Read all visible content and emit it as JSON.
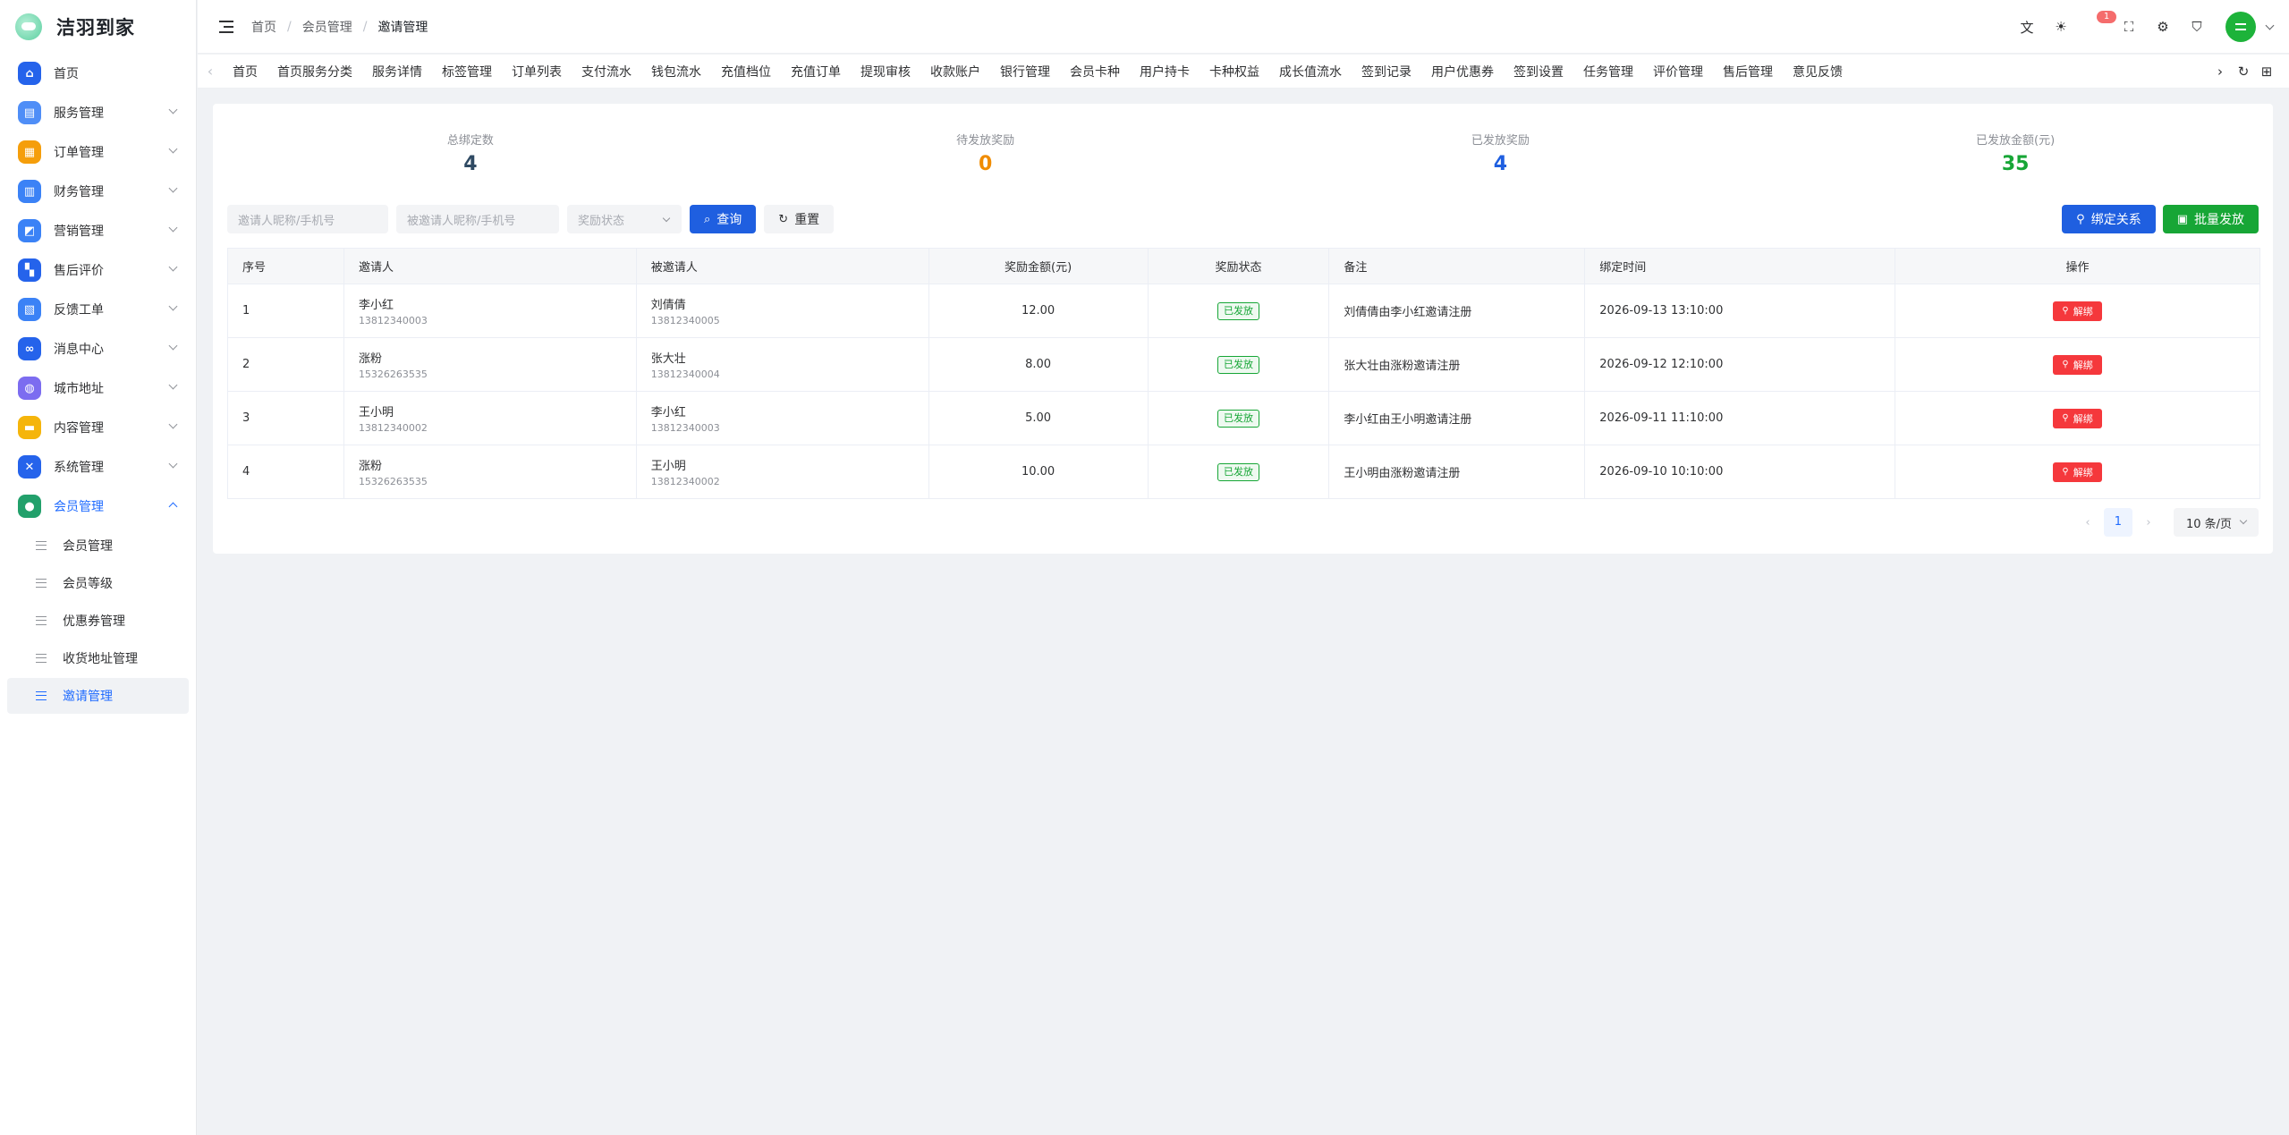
{
  "app": {
    "name": "洁羽到家"
  },
  "colors": {
    "primary": "#1f5fe0",
    "success": "#17a636",
    "danger": "#f5383c",
    "warning": "#f08c00",
    "stat_blue": "#1f5fe0",
    "stat_dark": "#2f4a63"
  },
  "sidebar": {
    "items": [
      {
        "label": "首页",
        "icon": "home-icon",
        "color": "#2563eb",
        "glyph": "⌂"
      },
      {
        "label": "服务管理",
        "icon": "clipboard-icon",
        "color": "#4f8ef7",
        "glyph": "▤"
      },
      {
        "label": "订单管理",
        "icon": "order-icon",
        "color": "#f59e0b",
        "glyph": "▦"
      },
      {
        "label": "财务管理",
        "icon": "document-icon",
        "color": "#3b82f6",
        "glyph": "▥"
      },
      {
        "label": "营销管理",
        "icon": "chart-icon",
        "color": "#3b82f6",
        "glyph": "◩"
      },
      {
        "label": "售后评价",
        "icon": "grid-icon",
        "color": "#2563eb",
        "glyph": "▚"
      },
      {
        "label": "反馈工单",
        "icon": "feedback-icon",
        "color": "#3b82f6",
        "glyph": "▧"
      },
      {
        "label": "消息中心",
        "icon": "link-icon",
        "color": "#2563eb",
        "glyph": "∞"
      },
      {
        "label": "城市地址",
        "icon": "planet-icon",
        "color": "#7c6cf0",
        "glyph": "◍"
      },
      {
        "label": "内容管理",
        "icon": "folder-icon",
        "color": "#f5b50b",
        "glyph": "▬"
      },
      {
        "label": "系统管理",
        "icon": "tools-icon",
        "color": "#2563eb",
        "glyph": "✕"
      },
      {
        "label": "会员管理",
        "icon": "user-icon",
        "color": "#22a06b",
        "glyph": "●"
      }
    ],
    "sub_items": [
      "会员管理",
      "会员等级",
      "优惠券管理",
      "收货地址管理",
      "邀请管理"
    ]
  },
  "header": {
    "breadcrumb": [
      "首页",
      "会员管理",
      "邀请管理"
    ],
    "badge_count": "1"
  },
  "tabs": [
    "首页",
    "首页服务分类",
    "服务详情",
    "标签管理",
    "订单列表",
    "支付流水",
    "钱包流水",
    "充值档位",
    "充值订单",
    "提现审核",
    "收款账户",
    "银行管理",
    "会员卡种",
    "用户持卡",
    "卡种权益",
    "成长值流水",
    "签到记录",
    "用户优惠券",
    "签到设置",
    "任务管理",
    "评价管理",
    "售后管理",
    "意见反馈"
  ],
  "stats": [
    {
      "label": "总绑定数",
      "value": "4",
      "color": "#2f4a63"
    },
    {
      "label": "待发放奖励",
      "value": "0",
      "color": "#f08c00"
    },
    {
      "label": "已发放奖励",
      "value": "4",
      "color": "#1f5fe0"
    },
    {
      "label": "已发放金额(元)",
      "value": "35",
      "color": "#17a636"
    }
  ],
  "search": {
    "inviter_placeholder": "邀请人昵称/手机号",
    "invitee_placeholder": "被邀请人昵称/手机号",
    "status_placeholder": "奖励状态",
    "query_label": "查询",
    "reset_label": "重置",
    "bind_label": "绑定关系",
    "batch_label": "批量发放"
  },
  "table": {
    "headers": [
      "序号",
      "邀请人",
      "被邀请人",
      "奖励金额(元)",
      "奖励状态",
      "备注",
      "绑定时间",
      "操作"
    ],
    "rows": [
      {
        "no": "1",
        "inviter": "李小红",
        "inviter_phone": "13812340003",
        "invitee": "刘倩倩",
        "invitee_phone": "13812340005",
        "amount": "12.00",
        "status": "已发放",
        "remark": "刘倩倩由李小红邀请注册",
        "time": "2026-09-13 13:10:00",
        "action": "解绑"
      },
      {
        "no": "2",
        "inviter": "涨粉",
        "inviter_phone": "15326263535",
        "invitee": "张大壮",
        "invitee_phone": "13812340004",
        "amount": "8.00",
        "status": "已发放",
        "remark": "张大壮由涨粉邀请注册",
        "time": "2026-09-12 12:10:00",
        "action": "解绑"
      },
      {
        "no": "3",
        "inviter": "王小明",
        "inviter_phone": "13812340002",
        "invitee": "李小红",
        "invitee_phone": "13812340003",
        "amount": "5.00",
        "status": "已发放",
        "remark": "李小红由王小明邀请注册",
        "time": "2026-09-11 11:10:00",
        "action": "解绑"
      },
      {
        "no": "4",
        "inviter": "涨粉",
        "inviter_phone": "15326263535",
        "invitee": "王小明",
        "invitee_phone": "13812340002",
        "amount": "10.00",
        "status": "已发放",
        "remark": "王小明由涨粉邀请注册",
        "time": "2026-09-10 10:10:00",
        "action": "解绑"
      }
    ]
  },
  "pagination": {
    "current": "1",
    "page_size": "10 条/页"
  }
}
